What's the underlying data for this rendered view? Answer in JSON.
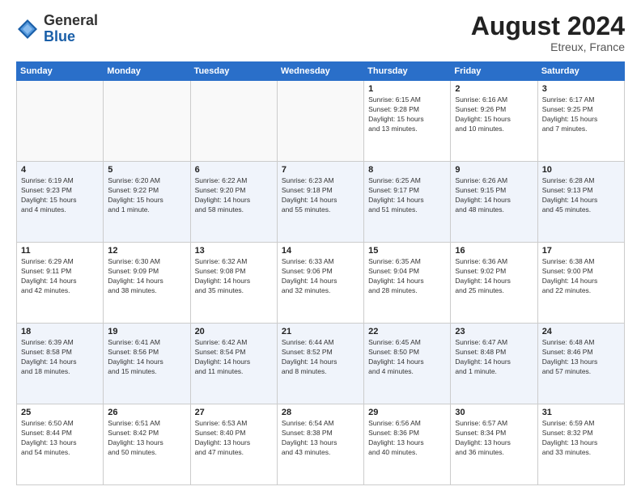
{
  "header": {
    "logo_general": "General",
    "logo_blue": "Blue",
    "month_year": "August 2024",
    "location": "Etreux, France"
  },
  "days_of_week": [
    "Sunday",
    "Monday",
    "Tuesday",
    "Wednesday",
    "Thursday",
    "Friday",
    "Saturday"
  ],
  "weeks": [
    [
      {
        "day": "",
        "info": ""
      },
      {
        "day": "",
        "info": ""
      },
      {
        "day": "",
        "info": ""
      },
      {
        "day": "",
        "info": ""
      },
      {
        "day": "1",
        "info": "Sunrise: 6:15 AM\nSunset: 9:28 PM\nDaylight: 15 hours\nand 13 minutes."
      },
      {
        "day": "2",
        "info": "Sunrise: 6:16 AM\nSunset: 9:26 PM\nDaylight: 15 hours\nand 10 minutes."
      },
      {
        "day": "3",
        "info": "Sunrise: 6:17 AM\nSunset: 9:25 PM\nDaylight: 15 hours\nand 7 minutes."
      }
    ],
    [
      {
        "day": "4",
        "info": "Sunrise: 6:19 AM\nSunset: 9:23 PM\nDaylight: 15 hours\nand 4 minutes."
      },
      {
        "day": "5",
        "info": "Sunrise: 6:20 AM\nSunset: 9:22 PM\nDaylight: 15 hours\nand 1 minute."
      },
      {
        "day": "6",
        "info": "Sunrise: 6:22 AM\nSunset: 9:20 PM\nDaylight: 14 hours\nand 58 minutes."
      },
      {
        "day": "7",
        "info": "Sunrise: 6:23 AM\nSunset: 9:18 PM\nDaylight: 14 hours\nand 55 minutes."
      },
      {
        "day": "8",
        "info": "Sunrise: 6:25 AM\nSunset: 9:17 PM\nDaylight: 14 hours\nand 51 minutes."
      },
      {
        "day": "9",
        "info": "Sunrise: 6:26 AM\nSunset: 9:15 PM\nDaylight: 14 hours\nand 48 minutes."
      },
      {
        "day": "10",
        "info": "Sunrise: 6:28 AM\nSunset: 9:13 PM\nDaylight: 14 hours\nand 45 minutes."
      }
    ],
    [
      {
        "day": "11",
        "info": "Sunrise: 6:29 AM\nSunset: 9:11 PM\nDaylight: 14 hours\nand 42 minutes."
      },
      {
        "day": "12",
        "info": "Sunrise: 6:30 AM\nSunset: 9:09 PM\nDaylight: 14 hours\nand 38 minutes."
      },
      {
        "day": "13",
        "info": "Sunrise: 6:32 AM\nSunset: 9:08 PM\nDaylight: 14 hours\nand 35 minutes."
      },
      {
        "day": "14",
        "info": "Sunrise: 6:33 AM\nSunset: 9:06 PM\nDaylight: 14 hours\nand 32 minutes."
      },
      {
        "day": "15",
        "info": "Sunrise: 6:35 AM\nSunset: 9:04 PM\nDaylight: 14 hours\nand 28 minutes."
      },
      {
        "day": "16",
        "info": "Sunrise: 6:36 AM\nSunset: 9:02 PM\nDaylight: 14 hours\nand 25 minutes."
      },
      {
        "day": "17",
        "info": "Sunrise: 6:38 AM\nSunset: 9:00 PM\nDaylight: 14 hours\nand 22 minutes."
      }
    ],
    [
      {
        "day": "18",
        "info": "Sunrise: 6:39 AM\nSunset: 8:58 PM\nDaylight: 14 hours\nand 18 minutes."
      },
      {
        "day": "19",
        "info": "Sunrise: 6:41 AM\nSunset: 8:56 PM\nDaylight: 14 hours\nand 15 minutes."
      },
      {
        "day": "20",
        "info": "Sunrise: 6:42 AM\nSunset: 8:54 PM\nDaylight: 14 hours\nand 11 minutes."
      },
      {
        "day": "21",
        "info": "Sunrise: 6:44 AM\nSunset: 8:52 PM\nDaylight: 14 hours\nand 8 minutes."
      },
      {
        "day": "22",
        "info": "Sunrise: 6:45 AM\nSunset: 8:50 PM\nDaylight: 14 hours\nand 4 minutes."
      },
      {
        "day": "23",
        "info": "Sunrise: 6:47 AM\nSunset: 8:48 PM\nDaylight: 14 hours\nand 1 minute."
      },
      {
        "day": "24",
        "info": "Sunrise: 6:48 AM\nSunset: 8:46 PM\nDaylight: 13 hours\nand 57 minutes."
      }
    ],
    [
      {
        "day": "25",
        "info": "Sunrise: 6:50 AM\nSunset: 8:44 PM\nDaylight: 13 hours\nand 54 minutes."
      },
      {
        "day": "26",
        "info": "Sunrise: 6:51 AM\nSunset: 8:42 PM\nDaylight: 13 hours\nand 50 minutes."
      },
      {
        "day": "27",
        "info": "Sunrise: 6:53 AM\nSunset: 8:40 PM\nDaylight: 13 hours\nand 47 minutes."
      },
      {
        "day": "28",
        "info": "Sunrise: 6:54 AM\nSunset: 8:38 PM\nDaylight: 13 hours\nand 43 minutes."
      },
      {
        "day": "29",
        "info": "Sunrise: 6:56 AM\nSunset: 8:36 PM\nDaylight: 13 hours\nand 40 minutes."
      },
      {
        "day": "30",
        "info": "Sunrise: 6:57 AM\nSunset: 8:34 PM\nDaylight: 13 hours\nand 36 minutes."
      },
      {
        "day": "31",
        "info": "Sunrise: 6:59 AM\nSunset: 8:32 PM\nDaylight: 13 hours\nand 33 minutes."
      }
    ]
  ]
}
